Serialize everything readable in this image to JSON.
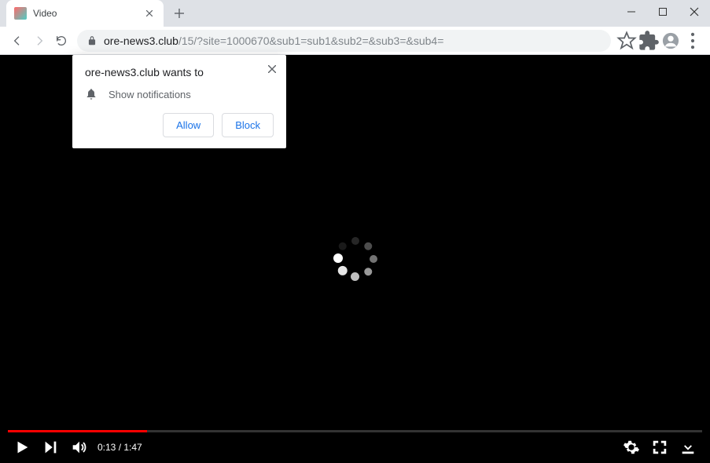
{
  "window": {
    "tab_title": "Video"
  },
  "address": {
    "host": "ore-news3.club",
    "path": "/15/?site=1000670&sub1=sub1&sub2=&sub3=&sub4="
  },
  "notification": {
    "prompt": "ore-news3.club wants to",
    "permission": "Show notifications",
    "allow": "Allow",
    "block": "Block"
  },
  "video": {
    "time": "0:13 / 1:47"
  }
}
